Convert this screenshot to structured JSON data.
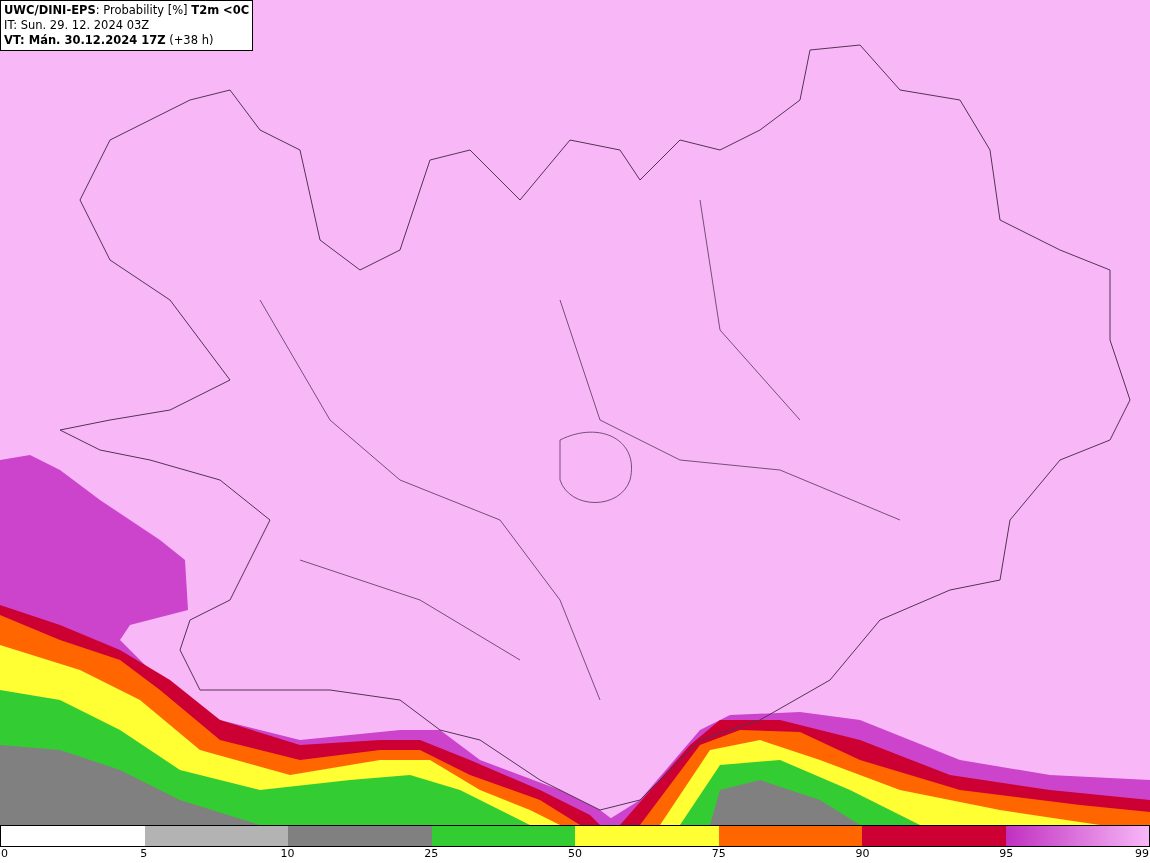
{
  "header": {
    "lines": [
      "**UWC/DINI-EPS**: Probability [%] **T2m <0C**",
      "IT: Sun. 29. 12. 2024 03Z",
      "**VT: Mán. 30.12.2024 17Z** (+38 h)"
    ]
  },
  "legend": {
    "segments": [
      {
        "kind": "blank"
      },
      {
        "kind": "solid",
        "color": "#b3b3b3"
      },
      {
        "kind": "solid",
        "color": "#808080"
      },
      {
        "kind": "solid",
        "color": "#33cc33"
      },
      {
        "kind": "solid",
        "color": "#ffff33"
      },
      {
        "kind": "solid",
        "color": "#ff6600"
      },
      {
        "kind": "solid",
        "color": "#cc0033"
      },
      {
        "kind": "gradient"
      }
    ],
    "ticks": [
      "0",
      "5",
      "10",
      "25",
      "50",
      "75",
      "90",
      "95",
      "99"
    ]
  }
}
